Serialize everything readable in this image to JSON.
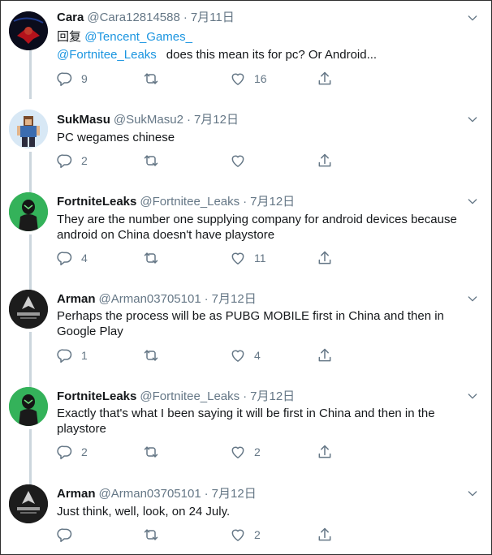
{
  "tweets": [
    {
      "name": "Cara",
      "handle": "@Cara12814588",
      "date": "7月11日",
      "reply_prefix": "回复",
      "reply_to": "@Tencent_Games_",
      "mention": "@Fortnitee_Leaks",
      "text": "does this mean its for pc? Or Android...",
      "replies": "9",
      "retweets": "",
      "likes": "16",
      "avatar_icon": "spider-avatar"
    },
    {
      "name": "SukMasu",
      "handle": "@SukMasu2",
      "date": "7月12日",
      "text": "PC wegames chinese",
      "replies": "2",
      "retweets": "",
      "likes": "",
      "avatar_icon": "minecraft-avatar"
    },
    {
      "name": "FortniteLeaks",
      "handle": "@Fortnitee_Leaks",
      "date": "7月12日",
      "text": "They are the number one supplying company for android devices because android on China doesn't have playstore",
      "replies": "4",
      "retweets": "",
      "likes": "11",
      "avatar_icon": "fortnite-skin-avatar"
    },
    {
      "name": "Arman",
      "handle": "@Arman03705101",
      "date": "7月12日",
      "text": "Perhaps the process will be as PUBG MOBILE first in China and then in Google Play",
      "replies": "1",
      "retweets": "",
      "likes": "4",
      "avatar_icon": "dark-logo-avatar"
    },
    {
      "name": "FortniteLeaks",
      "handle": "@Fortnitee_Leaks",
      "date": "7月12日",
      "text": "Exactly that's what I been saying it will be first in China and then in the playstore",
      "replies": "2",
      "retweets": "",
      "likes": "2",
      "avatar_icon": "fortnite-skin-avatar"
    },
    {
      "name": "Arman",
      "handle": "@Arman03705101",
      "date": "7月12日",
      "text": "Just think, well, look, on 24 July.",
      "replies": "",
      "retweets": "",
      "likes": "2",
      "avatar_icon": "dark-logo-avatar"
    }
  ],
  "colors": {
    "accent": "#1b95e0",
    "muted": "#657786",
    "line": "#ccd6dd",
    "text": "#14171a"
  },
  "icons": [
    "reply-icon",
    "retweet-icon",
    "like-icon",
    "share-icon",
    "chevron-down-icon"
  ]
}
